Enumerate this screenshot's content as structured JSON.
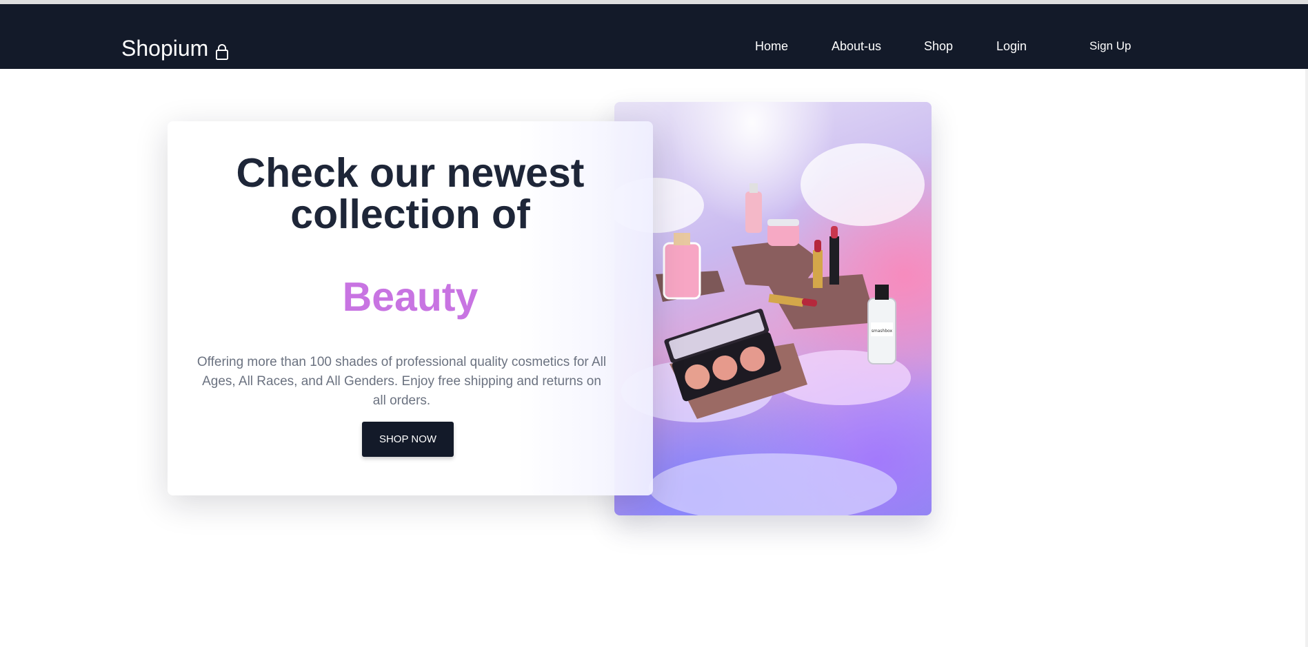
{
  "brand": {
    "name": "Shopium",
    "icon": "shopping-bag-icon"
  },
  "nav": {
    "home": "Home",
    "about": "About-us",
    "shop": "Shop",
    "login": "Login",
    "signup": "Sign Up"
  },
  "hero": {
    "headline": "Check our newest collection of",
    "accent": "Beauty",
    "description": "Offering more than 100 shades of professional quality cosmetics for All Ages, All Races, and All Genders. Enjoy free shipping and returns on all orders.",
    "cta": "SHOP NOW",
    "image_label": "smashbox"
  },
  "colors": {
    "navbar": "#131a29",
    "accent": "#c874e2",
    "headline": "#1e2638",
    "body_text": "#6b7280"
  }
}
